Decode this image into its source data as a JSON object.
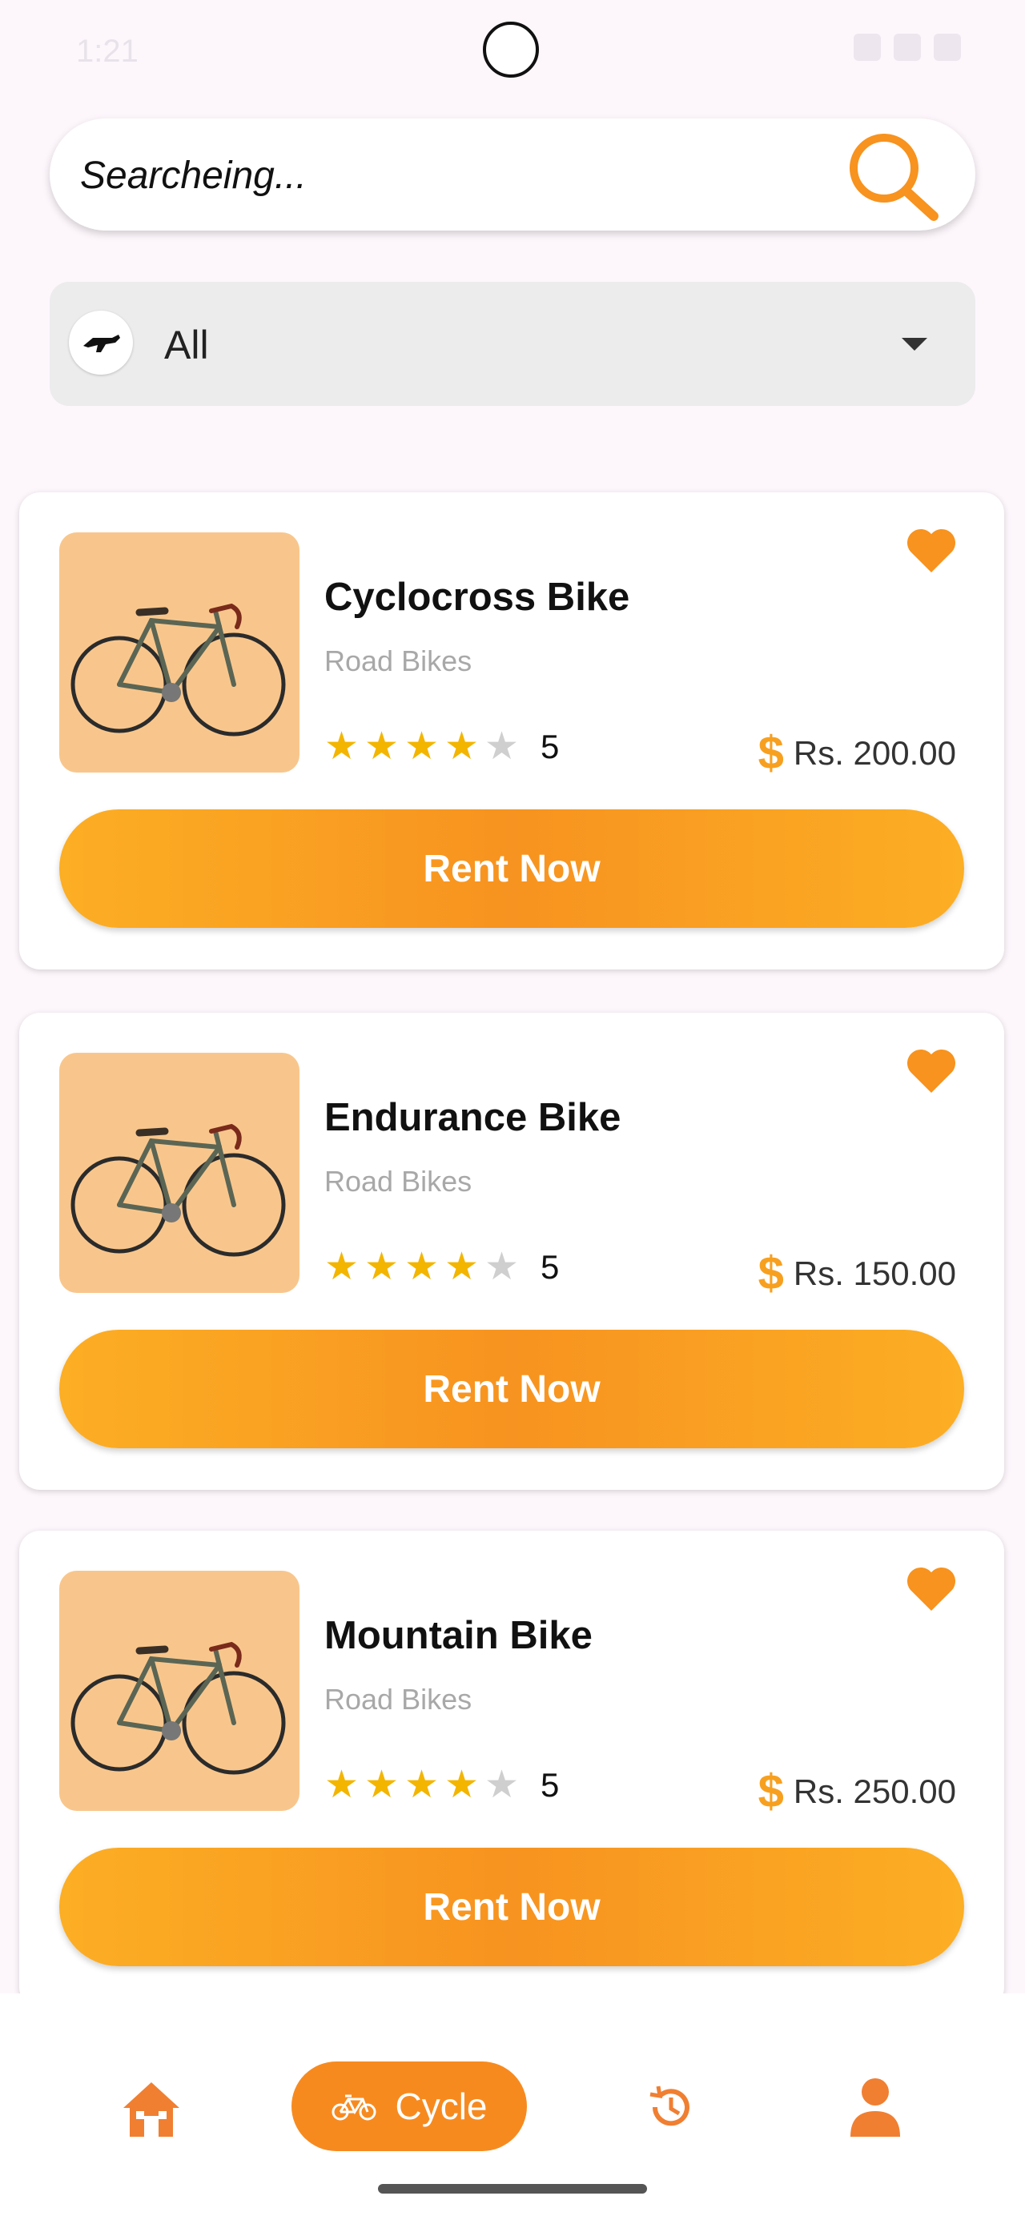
{
  "status_bar": {
    "time": "1:21"
  },
  "search": {
    "placeholder": "Searcheing..."
  },
  "category_filter": {
    "selected": "All"
  },
  "bikes": [
    {
      "name": "Cyclocross Bike",
      "category": "Road Bikes",
      "rating": "5",
      "stars_filled": 4,
      "stars_total": 5,
      "currency_symbol": "$",
      "price": "Rs. 200.00",
      "button_label": "Rent Now",
      "favorited": true
    },
    {
      "name": "Endurance Bike",
      "category": "Road Bikes",
      "rating": "5",
      "stars_filled": 4,
      "stars_total": 5,
      "currency_symbol": "$",
      "price": "Rs. 150.00",
      "button_label": "Rent Now",
      "favorited": true
    },
    {
      "name": "Mountain Bike",
      "category": "Road Bikes",
      "rating": "5",
      "stars_filled": 4,
      "stars_total": 5,
      "currency_symbol": "$",
      "price": "Rs. 250.00",
      "button_label": "Rent Now",
      "favorited": true
    }
  ],
  "bottom_nav": {
    "items": [
      {
        "icon": "home-icon",
        "label": ""
      },
      {
        "icon": "bicycle-icon",
        "label": "Cycle",
        "active": true
      },
      {
        "icon": "history-icon",
        "label": ""
      },
      {
        "icon": "profile-icon",
        "label": ""
      }
    ]
  },
  "colors": {
    "accent": "#f7931e",
    "accent_light": "#fcae24",
    "star": "#f3b500",
    "thumb_bg": "#f8c68c",
    "background": "#fdf7fc"
  }
}
